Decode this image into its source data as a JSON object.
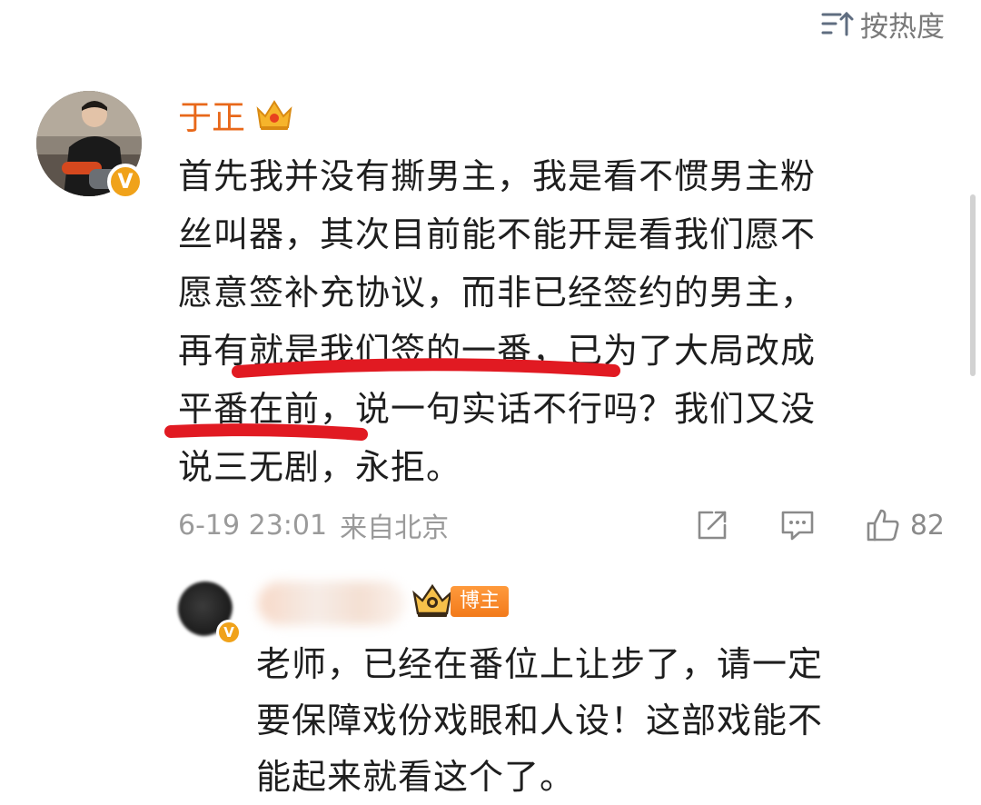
{
  "sort": {
    "label": "按热度"
  },
  "comment": {
    "username": "于正",
    "lines": [
      "首先我并没有撕男主，我是看不惯男主粉",
      "丝叫器，其次目前能不能开是看我们愿不",
      "愿意签补充协议，而非已经签约的男主，",
      "再有就是我们签的一番，已为了大局改成",
      "平番在前，说一句实话不行吗？我们又没",
      "说三无剧，永拒。"
    ],
    "time": "6-19 23:01",
    "source": "来自北京",
    "like_count": "82",
    "underline_color": "#e11a22"
  },
  "reply": {
    "tag": "博主",
    "lines": [
      "老师，已经在番位上让步了，请一定",
      "要保障戏份戏眼和人设！这部戏能不",
      "能起来就看这个了。"
    ]
  },
  "colors": {
    "username": "#e8681a",
    "meta": "#9a9a9a",
    "badge": "#f0a21a"
  },
  "icons": {
    "sort": "sort-icon",
    "crown": "crown-icon",
    "verified": "verified-v-icon",
    "share": "share-icon",
    "comment": "comment-icon",
    "like": "thumbs-up-icon"
  }
}
